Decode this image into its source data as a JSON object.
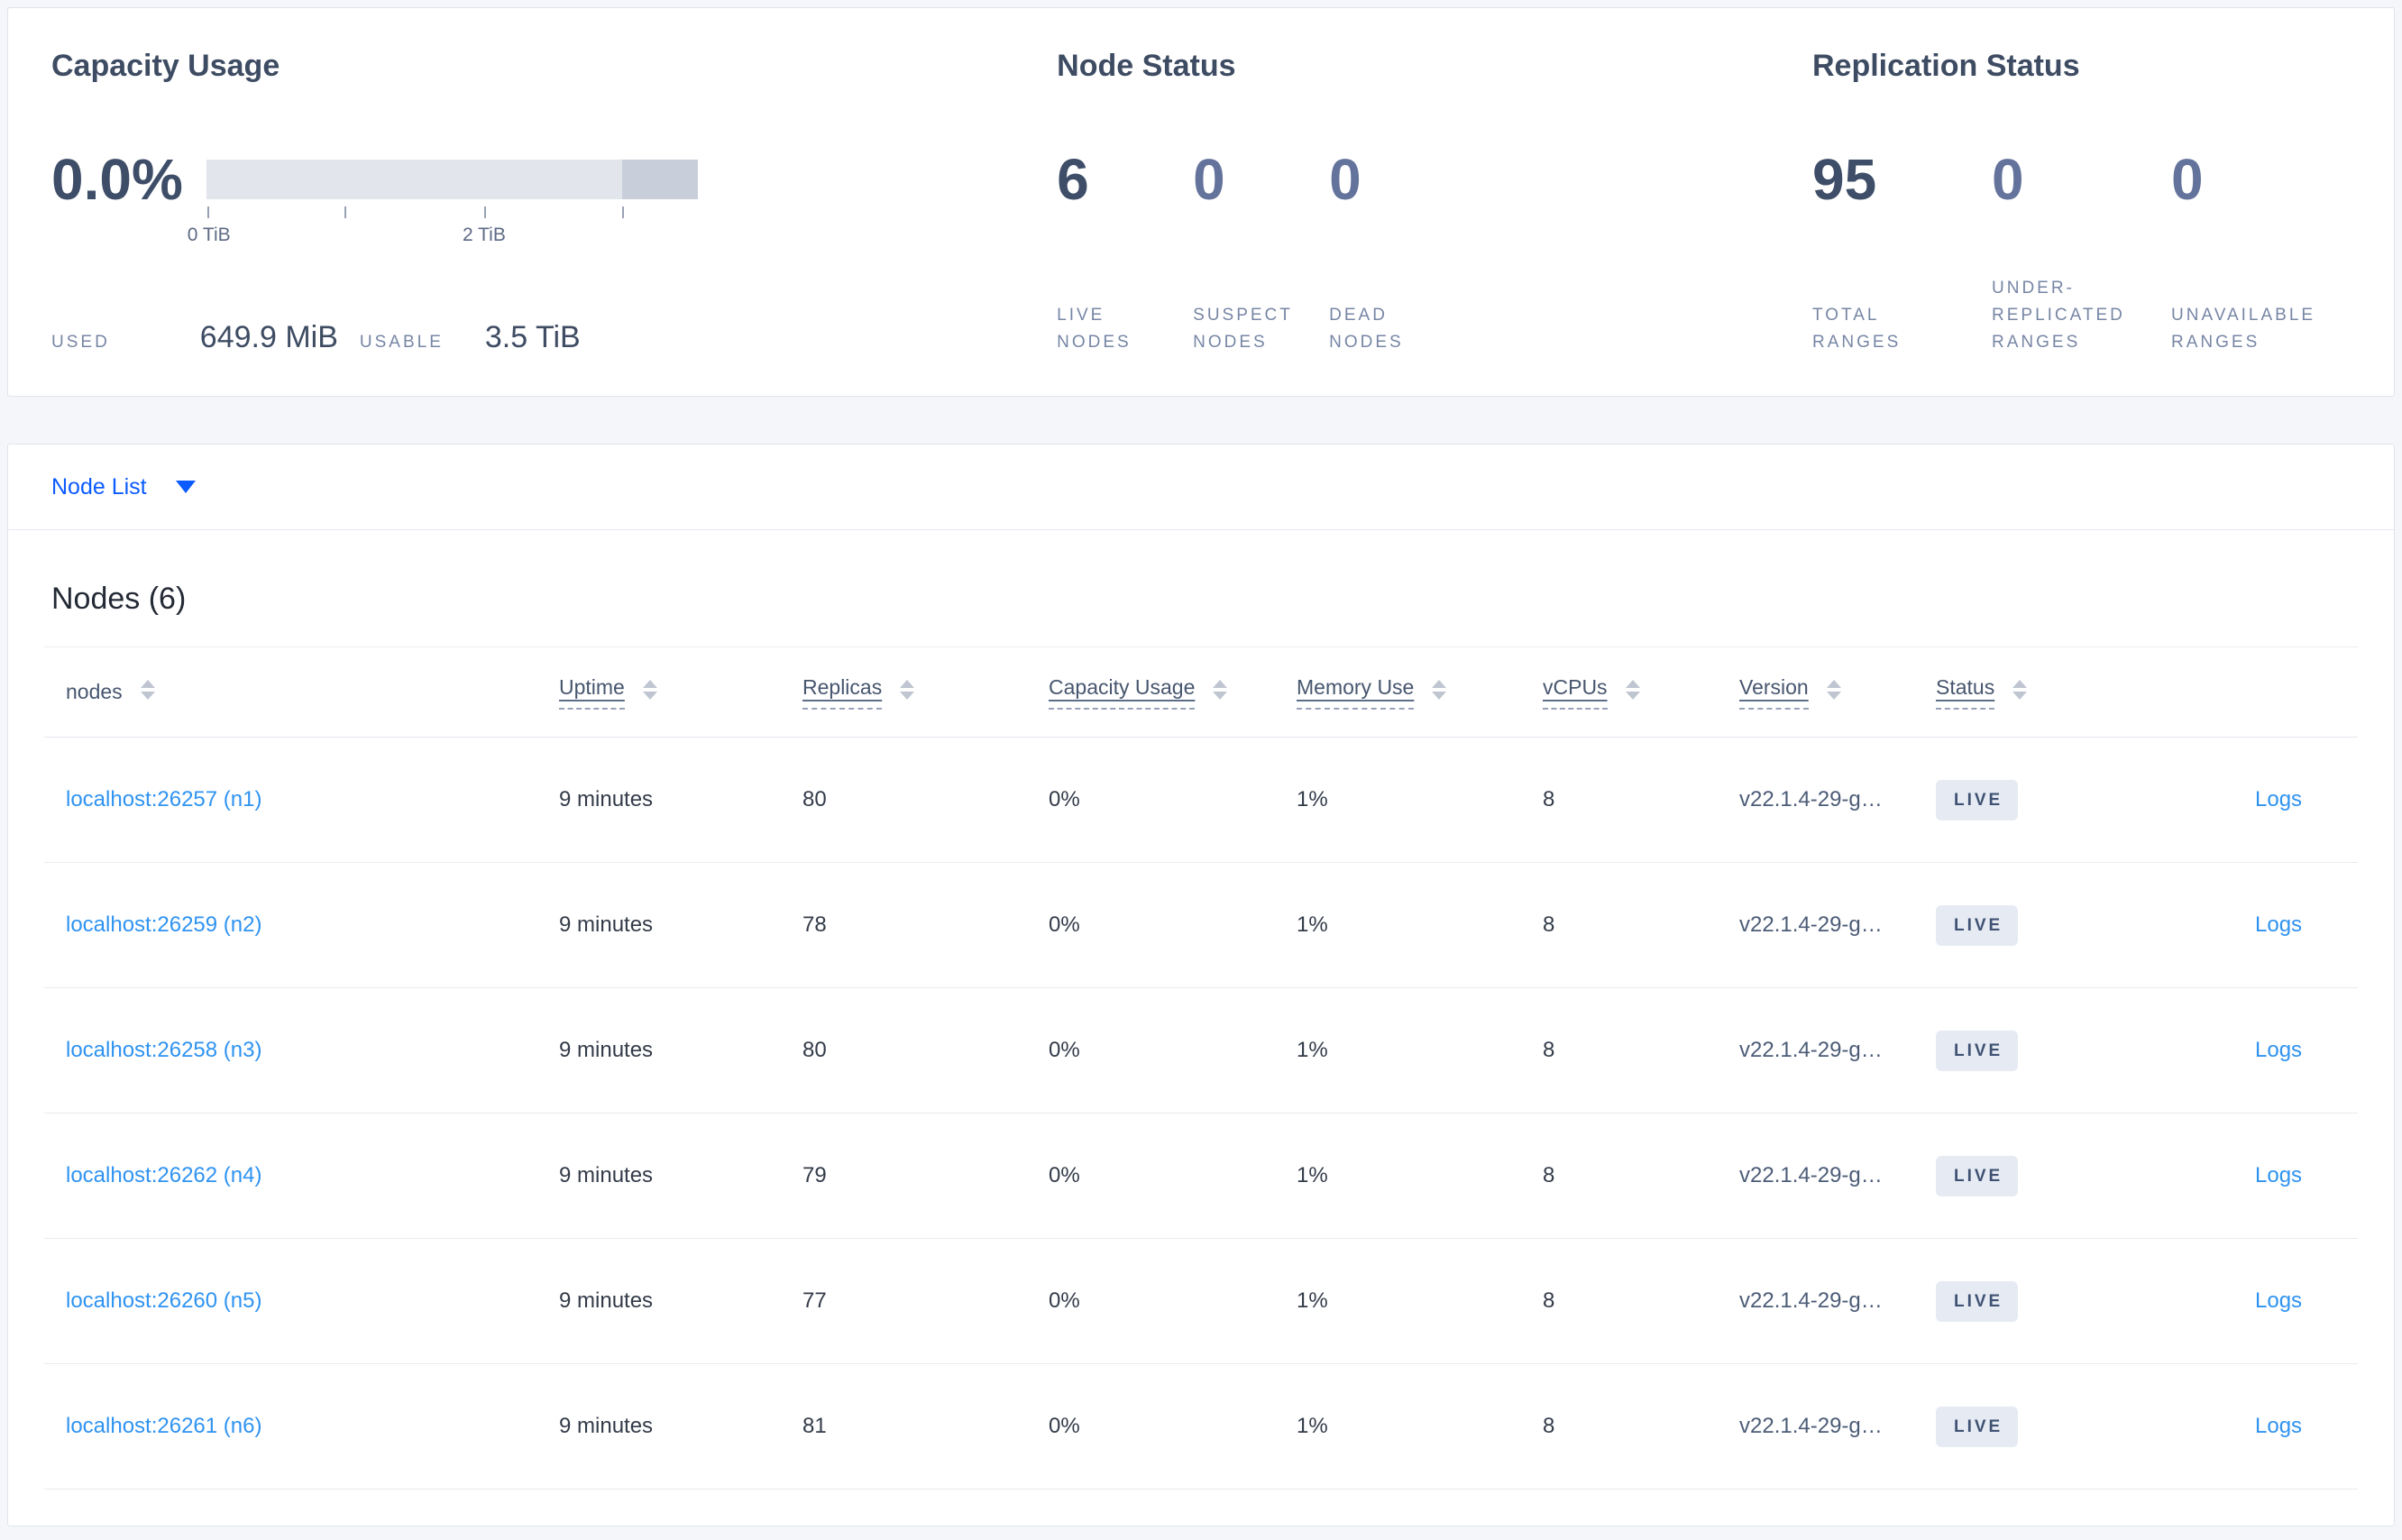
{
  "summary": {
    "capacity": {
      "title": "Capacity Usage",
      "percent": "0.0%",
      "gauge": {
        "used_fraction": 0.0,
        "reserved_fraction_start": 0.846,
        "tick_fractions": [
          0,
          0.281,
          0.565,
          0.846
        ],
        "tick_label_min": "0 TiB",
        "tick_label_mid": "2 TiB"
      },
      "used_label": "USED",
      "used_value": "649.9 MiB",
      "usable_label": "USABLE",
      "usable_value": "3.5 TiB"
    },
    "node_status": {
      "title": "Node Status",
      "stats": [
        {
          "value": "6",
          "label": "LIVE\nNODES",
          "tone": "dark"
        },
        {
          "value": "0",
          "label": "SUSPECT\nNODES",
          "tone": "light"
        },
        {
          "value": "0",
          "label": "DEAD\nNODES",
          "tone": "light"
        }
      ]
    },
    "replication_status": {
      "title": "Replication Status",
      "stats": [
        {
          "value": "95",
          "label": "TOTAL\nRANGES",
          "tone": "dark"
        },
        {
          "value": "0",
          "label": "UNDER-\nREPLICATED\nRANGES",
          "tone": "light"
        },
        {
          "value": "0",
          "label": "UNAVAILABLE\nRANGES",
          "tone": "light"
        }
      ]
    }
  },
  "node_list": {
    "dropdown_label": "Node List",
    "heading": "Nodes (6)",
    "columns": [
      {
        "label": "nodes"
      },
      {
        "label": "Uptime"
      },
      {
        "label": "Replicas"
      },
      {
        "label": "Capacity Usage"
      },
      {
        "label": "Memory Use"
      },
      {
        "label": "vCPUs"
      },
      {
        "label": "Version"
      },
      {
        "label": "Status"
      }
    ],
    "rows": [
      {
        "address": "localhost:26257 (n1)",
        "uptime": "9 minutes",
        "replicas": "80",
        "capacity_usage": "0%",
        "memory_use": "1%",
        "vcpus": "8",
        "version": "v22.1.4-29-g…",
        "status": "LIVE",
        "logs_label": "Logs"
      },
      {
        "address": "localhost:26259 (n2)",
        "uptime": "9 minutes",
        "replicas": "78",
        "capacity_usage": "0%",
        "memory_use": "1%",
        "vcpus": "8",
        "version": "v22.1.4-29-g…",
        "status": "LIVE",
        "logs_label": "Logs"
      },
      {
        "address": "localhost:26258 (n3)",
        "uptime": "9 minutes",
        "replicas": "80",
        "capacity_usage": "0%",
        "memory_use": "1%",
        "vcpus": "8",
        "version": "v22.1.4-29-g…",
        "status": "LIVE",
        "logs_label": "Logs"
      },
      {
        "address": "localhost:26262 (n4)",
        "uptime": "9 minutes",
        "replicas": "79",
        "capacity_usage": "0%",
        "memory_use": "1%",
        "vcpus": "8",
        "version": "v22.1.4-29-g…",
        "status": "LIVE",
        "logs_label": "Logs"
      },
      {
        "address": "localhost:26260 (n5)",
        "uptime": "9 minutes",
        "replicas": "77",
        "capacity_usage": "0%",
        "memory_use": "1%",
        "vcpus": "8",
        "version": "v22.1.4-29-g…",
        "status": "LIVE",
        "logs_label": "Logs"
      },
      {
        "address": "localhost:26261 (n6)",
        "uptime": "9 minutes",
        "replicas": "81",
        "capacity_usage": "0%",
        "memory_use": "1%",
        "vcpus": "8",
        "version": "v22.1.4-29-g…",
        "status": "LIVE",
        "logs_label": "Logs"
      }
    ]
  },
  "colors": {
    "page_bg": "#f4f6fa",
    "accent_blue": "#0b5bff",
    "link_blue": "#2f93f1",
    "badge_bg": "#e6ebf3",
    "badge_text": "#3f5273",
    "bar_light": "#e2e5eb",
    "bar_dark": "#c9cedb"
  }
}
